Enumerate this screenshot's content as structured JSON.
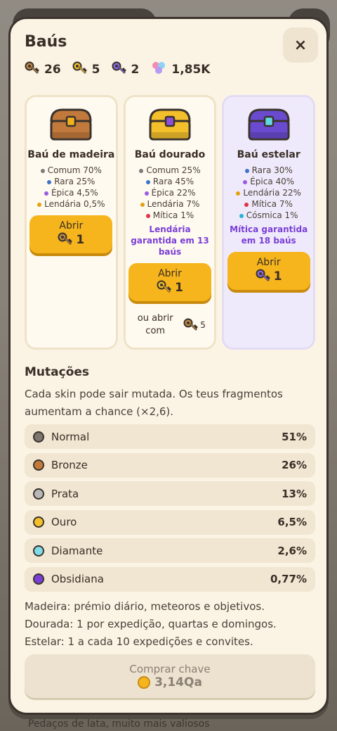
{
  "background": {
    "bottom_text": "Pedaços de lata, muito mais valiosos"
  },
  "modal": {
    "title": "Baús",
    "close_label": "×",
    "currencies": [
      {
        "icon": "bronze-key-icon",
        "value": "26",
        "color": "#c08a45"
      },
      {
        "icon": "gold-key-icon",
        "value": "5",
        "color": "#f3bf2b"
      },
      {
        "icon": "stellar-key-icon",
        "value": "2",
        "color": "#8f6ae0"
      },
      {
        "icon": "fragments-icon",
        "value": "1,85K"
      }
    ]
  },
  "chests": [
    {
      "name": "Baú de madeira",
      "color": "#c27a3c",
      "lock_color": "#f2b11b",
      "odds": [
        {
          "label": "Comum 70%",
          "color": "#7b7b7b"
        },
        {
          "label": "Rara 25%",
          "color": "#3d73c9"
        },
        {
          "label": "Épica 4,5%",
          "color": "#9a5ce0"
        },
        {
          "label": "Lendária 0,5%",
          "color": "#e3a214"
        }
      ],
      "guarantee": "",
      "open_label": "Abrir",
      "open_cost": "1",
      "key_icon": "bronze-key-icon"
    },
    {
      "name": "Baú dourado",
      "color": "#f3bf2b",
      "lock_color": "#8f4fd9",
      "odds": [
        {
          "label": "Comum 25%",
          "color": "#7b7b7b"
        },
        {
          "label": "Rara 45%",
          "color": "#3d73c9"
        },
        {
          "label": "Épica 22%",
          "color": "#9a5ce0"
        },
        {
          "label": "Lendária 7%",
          "color": "#e3a214"
        },
        {
          "label": "Mítica 1%",
          "color": "#e0334a"
        }
      ],
      "guarantee": "Lendária garantida em 13 baús",
      "open_label": "Abrir",
      "open_cost": "1",
      "key_icon": "gold-key-icon",
      "alt_text": "ou abrir com",
      "alt_cost": "5"
    },
    {
      "name": "Baú estelar",
      "color": "#6a4bd0",
      "lock_color": "#62d8e4",
      "odds": [
        {
          "label": "Rara 30%",
          "color": "#3d73c9"
        },
        {
          "label": "Épica 40%",
          "color": "#9a5ce0"
        },
        {
          "label": "Lendária 22%",
          "color": "#e3a214"
        },
        {
          "label": "Mítica 7%",
          "color": "#e0334a"
        },
        {
          "label": "Cósmica 1%",
          "color": "#25b3d6"
        }
      ],
      "guarantee": "Mítica garantida em 18 baús",
      "open_label": "Abrir",
      "open_cost": "1",
      "key_icon": "stellar-key-icon"
    }
  ],
  "mutations": {
    "title": "Mutações",
    "description": "Cada skin pode sair mutada. Os teus fragmentos aumentam a chance (×2,6).",
    "rows": [
      {
        "name": "Normal",
        "pct": "51%",
        "color": "#7c7670"
      },
      {
        "name": "Bronze",
        "pct": "26%",
        "color": "#c27a3c"
      },
      {
        "name": "Prata",
        "pct": "13%",
        "color": "#b8b8b8"
      },
      {
        "name": "Ouro",
        "pct": "6,5%",
        "color": "#f3bf2b"
      },
      {
        "name": "Diamante",
        "pct": "2,6%",
        "color": "#7fdce6"
      },
      {
        "name": "Obsidiana",
        "pct": "0,77%",
        "color": "#7a3fd6"
      }
    ]
  },
  "notes": [
    "Madeira: prémio diário, meteoros e objetivos.",
    "Dourada: 1 por expedição, quartas e domingos.",
    "Estelar: 1 a cada 10 expedições e convites."
  ],
  "buy_key": {
    "label": "Comprar chave",
    "cost": "3,14Qa"
  }
}
